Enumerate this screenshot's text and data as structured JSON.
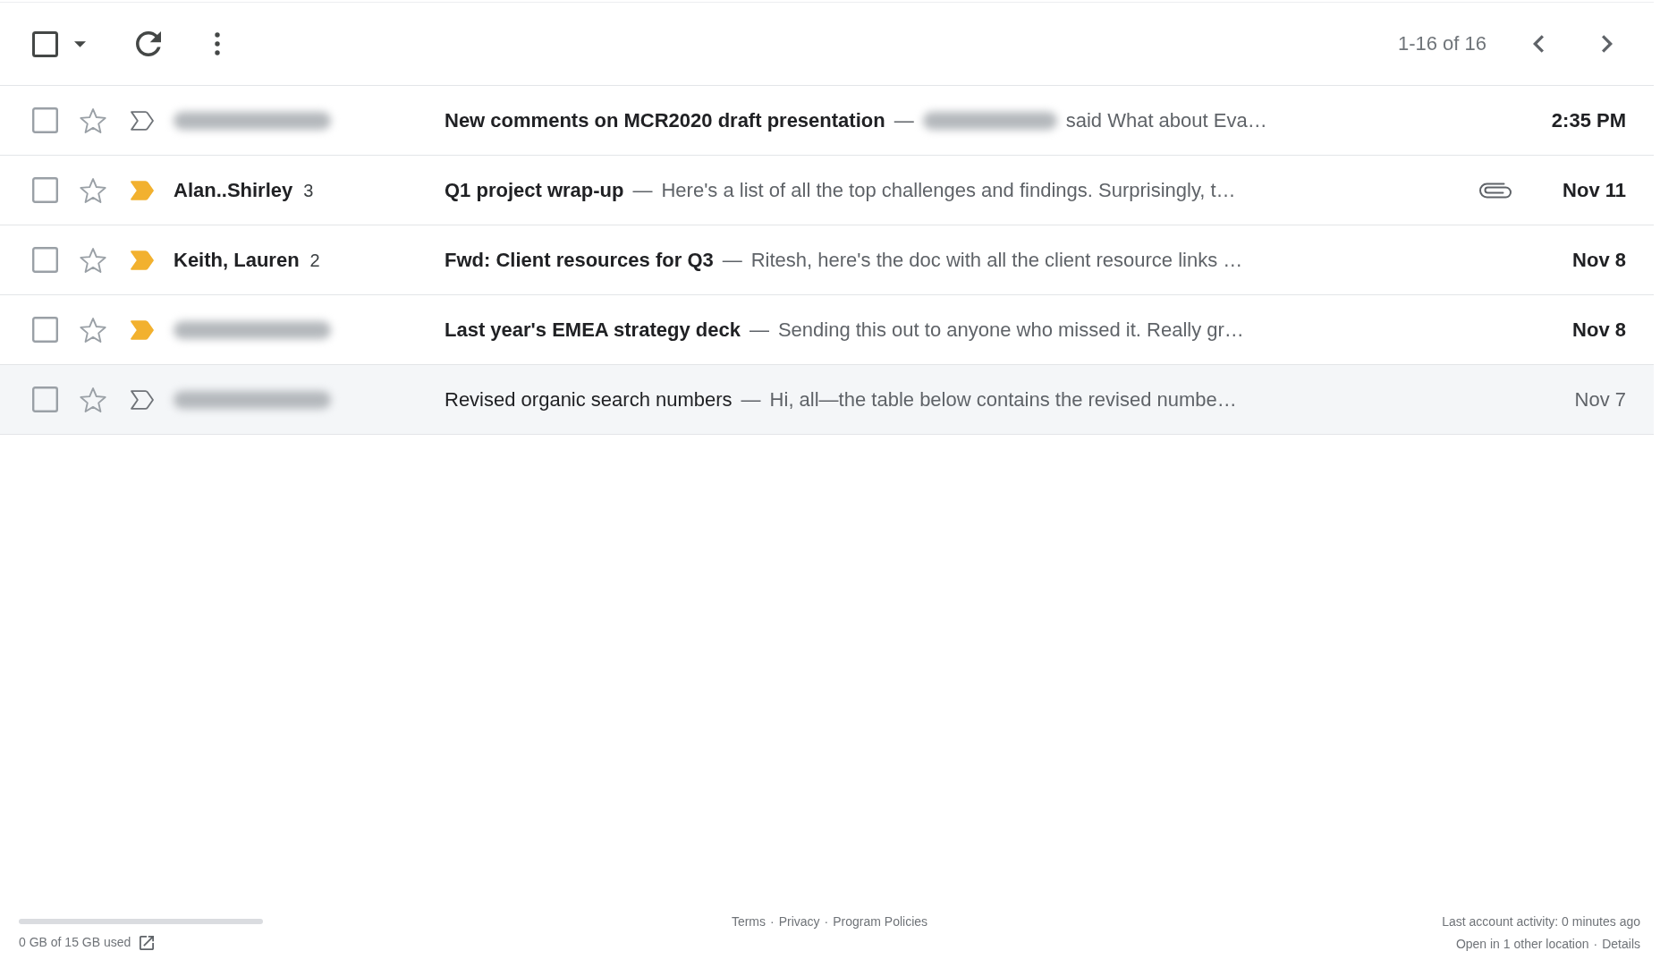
{
  "toolbar": {
    "select_all": {
      "checked": false
    },
    "pagination": "1-16 of 16"
  },
  "rows": [
    {
      "unread": true,
      "checked": false,
      "starred": false,
      "important": false,
      "sender": {
        "kind": "blurred"
      },
      "subject": "New comments on MCR2020 draft presentation",
      "separator": "—",
      "snippet_blurred_lead": true,
      "snippet": "said What about Eva…",
      "has_attachment": false,
      "date": "2:35 PM"
    },
    {
      "unread": true,
      "checked": false,
      "starred": false,
      "important": true,
      "sender": {
        "kind": "name",
        "name": "Alan..Shirley",
        "count": "3"
      },
      "subject": "Q1 project wrap-up",
      "separator": "—",
      "snippet_blurred_lead": false,
      "snippet": "Here's a list of all the top challenges and findings. Surprisingly, t…",
      "has_attachment": true,
      "date": "Nov 11"
    },
    {
      "unread": true,
      "checked": false,
      "starred": false,
      "important": true,
      "sender": {
        "kind": "name",
        "name": "Keith, Lauren",
        "count": "2"
      },
      "subject": "Fwd: Client resources for Q3",
      "separator": "—",
      "snippet_blurred_lead": false,
      "snippet": "Ritesh, here's the doc with all the client resource links …",
      "has_attachment": false,
      "date": "Nov 8"
    },
    {
      "unread": true,
      "checked": false,
      "starred": false,
      "important": true,
      "sender": {
        "kind": "blurred"
      },
      "subject": "Last year's EMEA strategy deck",
      "separator": "—",
      "snippet_blurred_lead": false,
      "snippet": "Sending this out to anyone who missed it. Really gr…",
      "has_attachment": false,
      "date": "Nov 8"
    },
    {
      "unread": false,
      "checked": false,
      "starred": false,
      "important": false,
      "sender": {
        "kind": "blurred"
      },
      "subject": "Revised organic search numbers",
      "separator": "—",
      "snippet_blurred_lead": false,
      "snippet": "Hi, all—the table below contains the revised numbe…",
      "has_attachment": false,
      "date": "Nov 7"
    }
  ],
  "footer": {
    "storage": {
      "level": 0,
      "text": "0 GB of 15 GB used"
    },
    "links": [
      "Terms",
      "Privacy",
      "Program Policies"
    ],
    "separator": "·",
    "activity": "Last account activity: 0 minutes ago",
    "sessions": "Open in 1 other location",
    "details_link": "Details"
  }
}
